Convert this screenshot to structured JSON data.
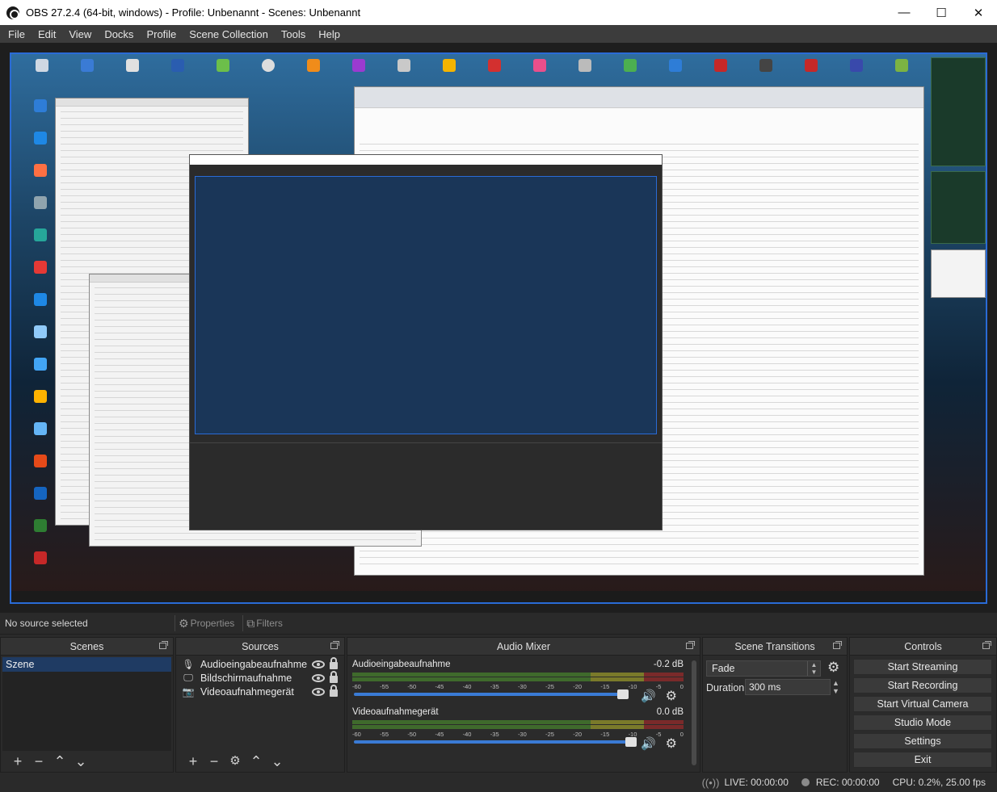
{
  "window": {
    "title": "OBS 27.2.4 (64-bit, windows) - Profile: Unbenannt - Scenes: Unbenannt",
    "minimize": "—",
    "maximize": "☐",
    "close": "✕"
  },
  "menu": [
    "File",
    "Edit",
    "View",
    "Docks",
    "Profile",
    "Scene Collection",
    "Tools",
    "Help"
  ],
  "source_toolbar": {
    "no_source": "No source selected",
    "properties": "Properties",
    "filters": "Filters"
  },
  "scenes": {
    "title": "Scenes",
    "items": [
      "Szene"
    ]
  },
  "sources": {
    "title": "Sources",
    "items": [
      "Audioeingabeaufnahme",
      "Bildschirmaufnahme",
      "Videoaufnahmegerät"
    ]
  },
  "mixer": {
    "title": "Audio Mixer",
    "ticks": [
      "-60",
      "-55",
      "-50",
      "-45",
      "-40",
      "-35",
      "-30",
      "-25",
      "-20",
      "-15",
      "-10",
      "-5",
      "0"
    ],
    "channels": [
      {
        "name": "Audioeingabeaufnahme",
        "db": "-0.2 dB",
        "volume": 0.97
      },
      {
        "name": "Videoaufnahmegerät",
        "db": "0.0 dB",
        "volume": 1.0
      }
    ]
  },
  "transitions": {
    "title": "Scene Transitions",
    "selected": "Fade",
    "duration_label": "Duration",
    "duration_value": "300 ms"
  },
  "controls": {
    "title": "Controls",
    "buttons": [
      "Start Streaming",
      "Start Recording",
      "Start Virtual Camera",
      "Studio Mode",
      "Settings",
      "Exit"
    ]
  },
  "status": {
    "live": "LIVE: 00:00:00",
    "rec": "REC: 00:00:00",
    "cpu": "CPU: 0.2%, 25.00 fps"
  },
  "colors": {
    "accent": "#2a6bd6",
    "selection": "#1f3b63",
    "panel": "#2b2b2b"
  }
}
